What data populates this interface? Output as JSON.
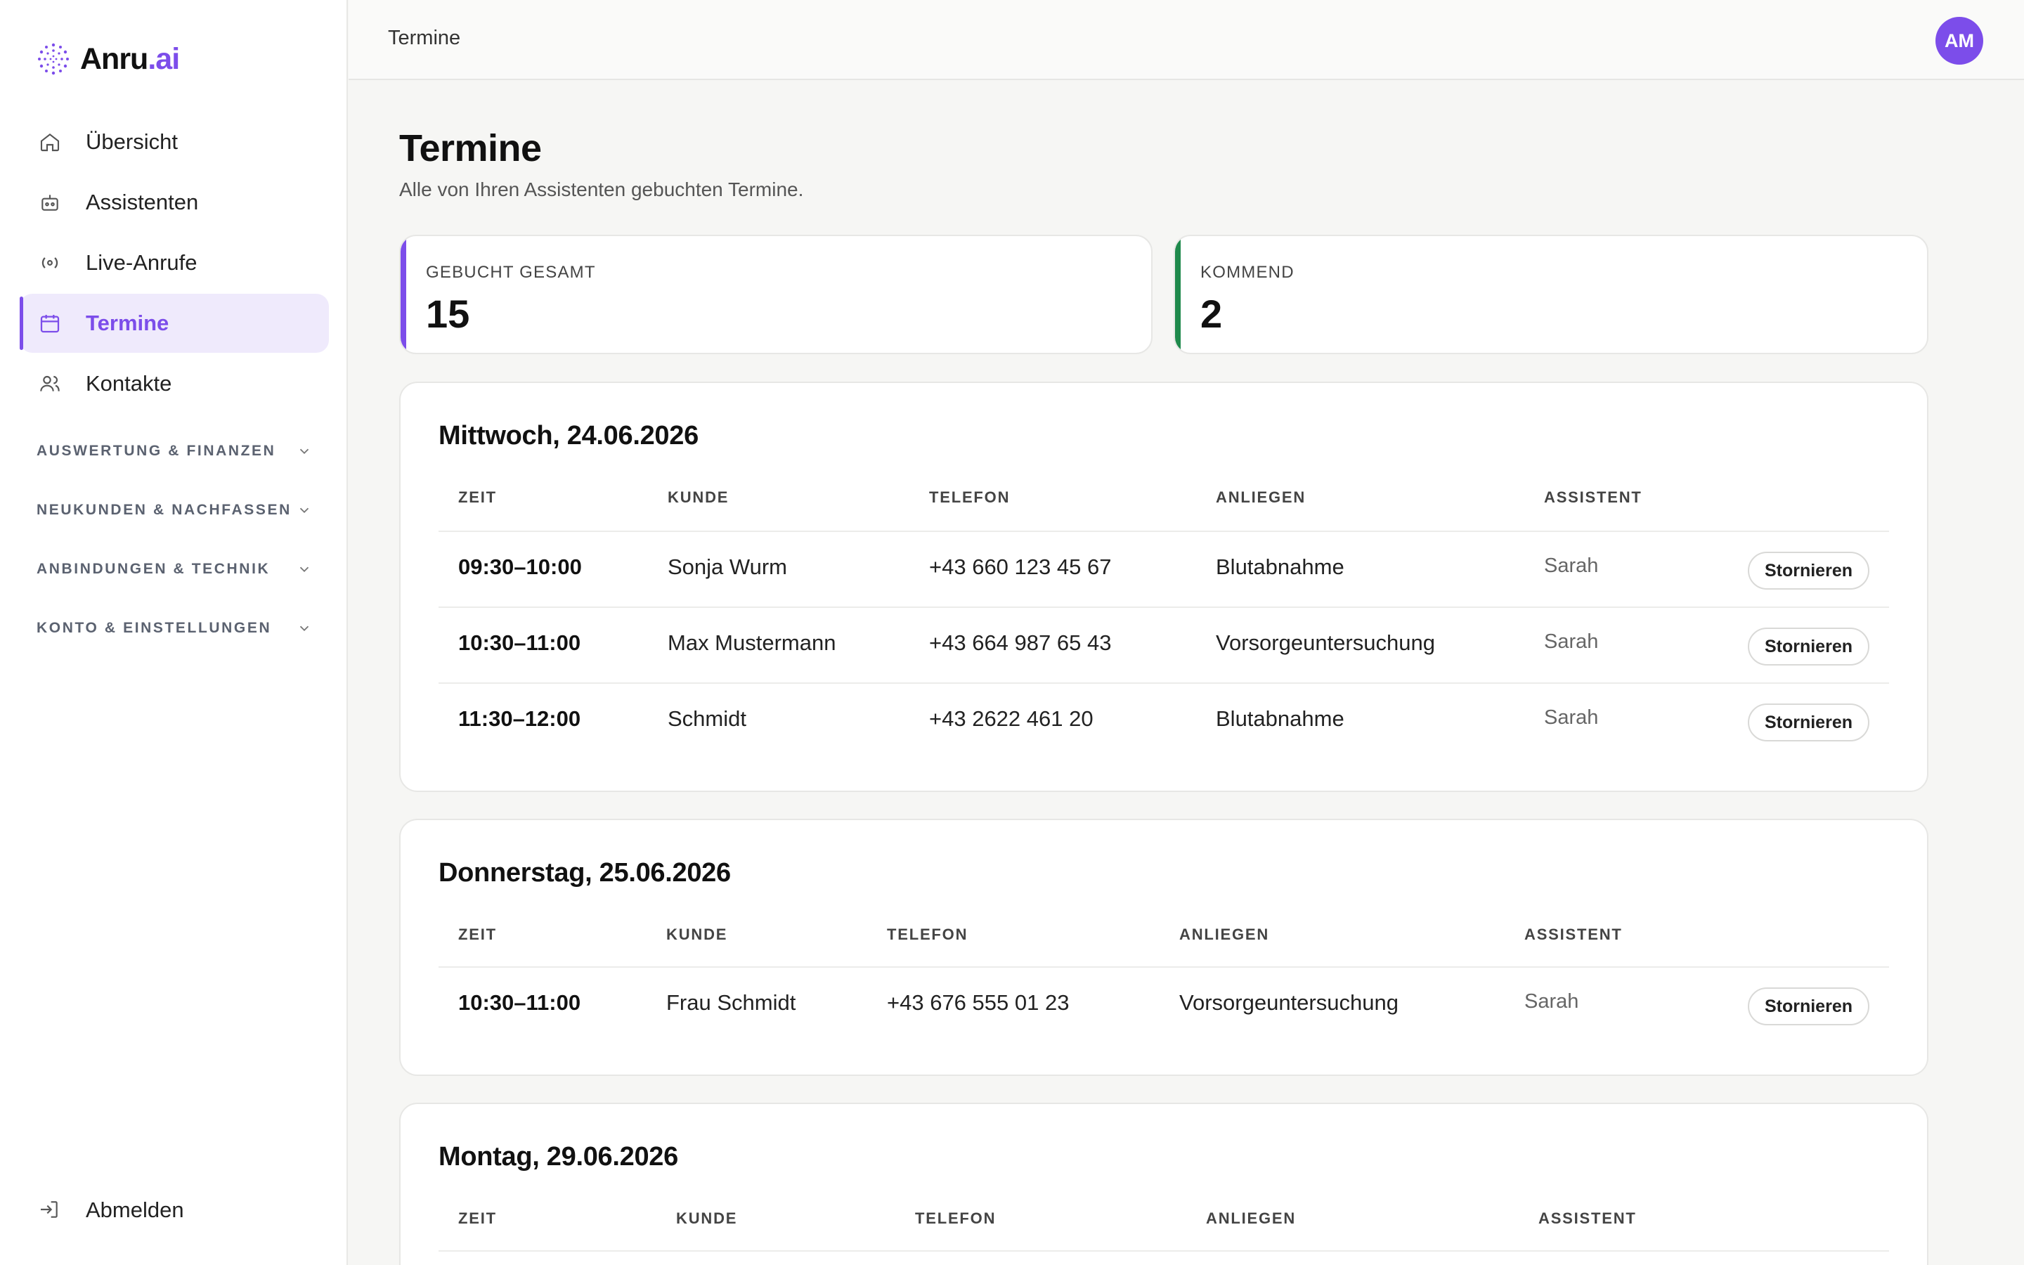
{
  "brand": {
    "name_main": "Anru",
    "name_accent": ".ai"
  },
  "nav": {
    "items": [
      {
        "label": "Übersicht",
        "icon": "home-icon"
      },
      {
        "label": "Assistenten",
        "icon": "robot-icon"
      },
      {
        "label": "Live-Anrufe",
        "icon": "broadcast-icon"
      },
      {
        "label": "Termine",
        "icon": "calendar-icon",
        "active": true
      },
      {
        "label": "Kontakte",
        "icon": "users-icon"
      }
    ],
    "sections": [
      "AUSWERTUNG & FINANZEN",
      "NEUKUNDEN & NACHFASSEN",
      "ANBINDUNGEN & TECHNIK",
      "KONTO & EINSTELLUNGEN"
    ],
    "logout": "Abmelden"
  },
  "topbar": {
    "title": "Termine",
    "avatar": "AM"
  },
  "page": {
    "title": "Termine",
    "subtitle": "Alle von Ihren Assistenten gebuchten Termine."
  },
  "stats": [
    {
      "label": "GEBUCHT GESAMT",
      "value": "15",
      "color": "#7c4dea"
    },
    {
      "label": "KOMMEND",
      "value": "2",
      "color": "#1f8a4c"
    }
  ],
  "columns": {
    "zeit": "ZEIT",
    "kunde": "KUNDE",
    "telefon": "TELEFON",
    "anliegen": "ANLIEGEN",
    "assistent": "ASSISTENT"
  },
  "cancel_label": "Stornieren",
  "days": [
    {
      "title": "Mittwoch, 24.06.2026",
      "rows": [
        {
          "zeit": "09:30–10:00",
          "kunde": "Sonja Wurm",
          "telefon": "+43 660 123 45 67",
          "anliegen": "Blutabnahme",
          "assistent": "Sarah"
        },
        {
          "zeit": "10:30–11:00",
          "kunde": "Max Mustermann",
          "telefon": "+43 664 987 65 43",
          "anliegen": "Vorsorgeuntersuchung",
          "assistent": "Sarah"
        },
        {
          "zeit": "11:30–12:00",
          "kunde": "Schmidt",
          "telefon": "+43 2622 461 20",
          "anliegen": "Blutabnahme",
          "assistent": "Sarah"
        }
      ]
    },
    {
      "title": "Donnerstag, 25.06.2026",
      "rows": [
        {
          "zeit": "10:30–11:00",
          "kunde": "Frau Schmidt",
          "telefon": "+43 676 555 01 23",
          "anliegen": "Vorsorgeuntersuchung",
          "assistent": "Sarah"
        }
      ]
    },
    {
      "title": "Montag, 29.06.2026",
      "rows": []
    }
  ]
}
